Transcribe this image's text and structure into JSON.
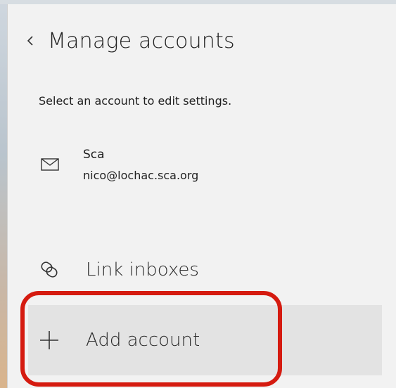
{
  "header": {
    "title": "Manage accounts",
    "back_icon": "chevron-left-icon"
  },
  "subtitle": "Select an account to edit settings.",
  "accounts": [
    {
      "name": "Sca",
      "email": "nico@lochac.sca.org",
      "icon": "mail-icon"
    }
  ],
  "actions": {
    "link_inboxes": {
      "label": "Link inboxes",
      "icon": "link-icon"
    },
    "add_account": {
      "label": "Add account",
      "icon": "plus-icon"
    }
  },
  "colors": {
    "highlight": "#d51b10",
    "panel_bg": "#f2f2f2",
    "selected_row_bg": "#e3e3e3"
  }
}
